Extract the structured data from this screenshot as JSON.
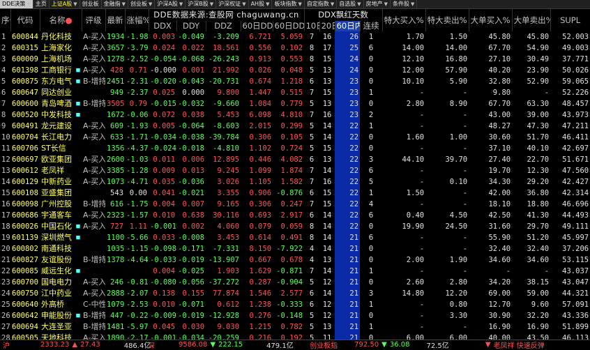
{
  "tabs": [
    {
      "label": "DDE决策",
      "arrow": "▼",
      "active": true
    },
    {
      "label": "主页",
      "arrow": ""
    },
    {
      "label": "上证A股",
      "arrow": "▼",
      "hl": true
    },
    {
      "label": "创业板",
      "arrow": ""
    },
    {
      "label": "金融指",
      "arrow": "▼"
    },
    {
      "label": "创业板",
      "arrow": "▼"
    },
    {
      "label": "沪深A股",
      "arrow": "▼"
    },
    {
      "label": "沪深B股",
      "arrow": "▼"
    },
    {
      "label": "沪深权证",
      "arrow": "▼"
    },
    {
      "label": "AH股",
      "arrow": "▼"
    },
    {
      "label": "板块指数",
      "arrow": "▼"
    },
    {
      "label": "自定指数",
      "arrow": "▼"
    },
    {
      "label": "自选股",
      "arrow": "▼"
    },
    {
      "label": "房地产",
      "arrow": "▼"
    },
    {
      "label": "条件股",
      "arrow": "▼"
    }
  ],
  "header": {
    "idx": "序号",
    "code": "代码",
    "name": "名称",
    "name_mark": "●",
    "rate": "评级",
    "latest": "最新",
    "pct": "涨幅%",
    "ddx_group": "DDE数据来源:查股网 chaguwang.cn",
    "red_group": "DDX飘红天数",
    "ddx": "DDX",
    "ddy": "DDY",
    "ddz": "DDZ",
    "ddx60": "60日DDX",
    "ddy60": "60日DDY",
    "r10": "10日内",
    "r20": "20日内",
    "r60": "60日内↓",
    "lianxu": "连续",
    "tdbuy": "特大买入%",
    "tdsell": "特大卖出%",
    "ddbuy": "大单买入%",
    "ddsell": "大单卖出%",
    "supl": "SUPL"
  },
  "rows": [
    [
      "1",
      "600844",
      "丹化科技",
      "",
      "A-买入",
      "1934",
      "-1.98",
      "0.003",
      "-0.049",
      "-3.209",
      "6.721",
      "5.059",
      "7",
      "16",
      "26",
      "1",
      "1.70",
      "1.50",
      "45.80",
      "45.80",
      "52.003"
    ],
    [
      "2",
      "600315",
      "上海家化",
      "",
      "A-买入",
      "3657",
      "-3.79",
      "0.024",
      "0.022",
      "18.561",
      "0.556",
      "0.102",
      "8",
      "17",
      "25",
      "6",
      "14.00",
      "14.00",
      "67.70",
      "54.90",
      "49.003"
    ],
    [
      "3",
      "600009",
      "上海机场",
      "",
      "A-买入",
      "1278",
      "-2.52",
      "-0.054",
      "-0.068",
      "-26.243",
      "0.913",
      "0.553",
      "8",
      "15",
      "24",
      "0",
      "12.10",
      "16.80",
      "27.10",
      "30.49",
      "37.771"
    ],
    [
      "4",
      "601398",
      "工商银行",
      "■",
      "A-买入",
      "428",
      "0.71",
      "-0.000",
      "0.001",
      "21.992",
      "0.026",
      "0.048",
      "5",
      "13",
      "24",
      "0",
      "12.00",
      "57.90",
      "40.20",
      "23.90",
      "50.026"
    ],
    [
      "5",
      "600875",
      "东方电气",
      "■",
      "B-增持",
      "2451",
      "-2.31",
      "-0.020",
      "-0.043",
      "-20.731",
      "0.674",
      "1.218",
      "6",
      "13",
      "23",
      "0",
      "10.10",
      "5.90",
      "32.80",
      "52.90",
      "59.065"
    ],
    [
      "6",
      "600647",
      "同达创业",
      "",
      "",
      "949",
      "-2.37",
      "0.025",
      "0.000",
      "9.800",
      "1.447",
      "0.515",
      "7",
      "15",
      "23",
      "1",
      "-",
      "-",
      "9.80",
      "-",
      "52.226"
    ],
    [
      "7",
      "600600",
      "青岛啤酒",
      "■",
      "B-增持",
      "3505",
      "0.79",
      "-0.015",
      "-0.032",
      "-9.660",
      "1.084",
      "0.779",
      "5",
      "13",
      "23",
      "0",
      "2.80",
      "8.90",
      "67.70",
      "63.30",
      "48.457"
    ],
    [
      "8",
      "600520",
      "中发科技",
      "■",
      "",
      "1672",
      "-0.06",
      "0.072",
      "0.038",
      "5.453",
      "6.098",
      "4.810",
      "7",
      "16",
      "23",
      "2",
      "-",
      "-",
      "43.00",
      "39.00",
      "43.973"
    ],
    [
      "9",
      "600491",
      "龙元建设",
      "",
      "A-买入",
      "609",
      "-1.93",
      "0.005",
      "-0.064",
      "-8.603",
      "2.015",
      "0.299",
      "5",
      "14",
      "22",
      "1",
      "-",
      "-",
      "48.27",
      "47.30",
      "47.211"
    ],
    [
      "10",
      "600704",
      "长江电力",
      "",
      "A-买入",
      "633",
      "-1.71",
      "-0.034",
      "-0.038",
      "-39.784",
      "0.306",
      "0.105",
      "5",
      "14",
      "22",
      "0",
      "1.60",
      "1.00",
      "30.60",
      "51.70",
      "46.411"
    ],
    [
      "11",
      "600706",
      "ST长信",
      "",
      "",
      "1356",
      "-4.37",
      "-0.024",
      "-0.018",
      "-4.810",
      "1.102",
      "0.724",
      "5",
      "15",
      "22",
      "0",
      "-",
      "-",
      "37.10",
      "40.10",
      "42.697"
    ],
    [
      "12",
      "600697",
      "欧亚集团",
      "",
      "A-买入",
      "2600",
      "-1.03",
      "0.011",
      "0.006",
      "12.895",
      "0.446",
      "4.082",
      "6",
      "13",
      "22",
      "3",
      "44.10",
      "39.70",
      "27.40",
      "22.70",
      "51.671"
    ],
    [
      "13",
      "600612",
      "老凤祥",
      "",
      "A-买入",
      "3385",
      "-1.28",
      "0.009",
      "0.013",
      "9.245",
      "1.099",
      "1.874",
      "7",
      "14",
      "22",
      "6",
      "-",
      "-",
      "19.70",
      "12.30",
      "47.560"
    ],
    [
      "14",
      "600129",
      "中新药业",
      "",
      "A-买入",
      "1073",
      "-4.71",
      "0.035",
      "-0.036",
      "3.026",
      "1.105",
      "1.582",
      "7",
      "16",
      "22",
      "5",
      "-",
      "0.10",
      "34.30",
      "29.20",
      "42.427"
    ],
    [
      "15",
      "600108",
      "亚盛集团",
      "",
      "",
      "543",
      "0.00",
      "0.041",
      "-0.021",
      "3.355",
      "0.906",
      "-0.876",
      "6",
      "15",
      "22",
      "1",
      "1.50",
      "-",
      "42.00",
      "36.80",
      "42.314"
    ],
    [
      "16",
      "600098",
      "广州控股",
      "",
      "B-增持",
      "616",
      "-1.75",
      "0.004",
      "0.007",
      "9.165",
      "0.306",
      "0.247",
      "7",
      "15",
      "22",
      "4",
      "-",
      "-",
      "18.10",
      "18.80",
      "46.696"
    ],
    [
      "17",
      "600686",
      "宇通客车",
      "",
      "A-买入",
      "2323",
      "-1.57",
      "0.010",
      "0.638",
      "30.116",
      "0.693",
      "2.917",
      "6",
      "14",
      "22",
      "6",
      "0.40",
      "4.50",
      "42.50",
      "41.30",
      "44.493"
    ],
    [
      "18",
      "600026",
      "中国石化",
      "■",
      "A-买入",
      "727",
      "1.11",
      "-0.001",
      "0.002",
      "4.060",
      "0.079",
      "0.059",
      "8",
      "14",
      "22",
      "0",
      "19.90",
      "24.50",
      "31.60",
      "29.70",
      "49.111"
    ],
    [
      "19",
      "601139",
      "深圳燃气",
      "■",
      "",
      "1100",
      "-5.66",
      "0.033",
      "-0.008",
      "3.453",
      "0.614",
      "0.491",
      "8",
      "14",
      "21",
      "6",
      "-",
      "-",
      "55.90",
      "51.20",
      "45.997"
    ],
    [
      "20",
      "600802",
      "南通科技",
      "",
      "",
      "1035",
      "-1.15",
      "-0.098",
      "-0.171",
      "-7.331",
      "8.150",
      "-7.922",
      "4",
      "14",
      "21",
      "0",
      "-",
      "-",
      "32.40",
      "32.40",
      "37.206"
    ],
    [
      "21",
      "600827",
      "友谊股份",
      "",
      "B-增持",
      "1378",
      "-4.64",
      "-0.033",
      "-0.019",
      "-13.907",
      "0.667",
      "0.678",
      "4",
      "13",
      "21",
      "0",
      "2.00",
      "1.90",
      "34.60",
      "34.60",
      "53.115"
    ],
    [
      "22",
      "600085",
      "威远生化",
      "■",
      "",
      "",
      "",
      "0.004",
      "-0.025",
      "1.903",
      "1.629",
      "-0.871",
      "7",
      "14",
      "21",
      "1",
      "-",
      "-",
      "-",
      "-",
      "43.037"
    ],
    [
      "23",
      "600700",
      "国电电力",
      "",
      "A-买入",
      "246",
      "-0.81",
      "-0.080",
      "-0.056",
      "-37.272",
      "0.287",
      "-0.904",
      "5",
      "12",
      "21",
      "0",
      "2.60",
      "2.80",
      "34.20",
      "38.15",
      "43.047"
    ],
    [
      "24",
      "600750",
      "江中药业",
      "",
      "A-买入",
      "2888",
      "-2.07",
      "0.138",
      "0.155",
      "77.874",
      "1.546",
      "2.577",
      "6",
      "14",
      "21",
      "3",
      "14.80",
      "12.20",
      "69.00",
      "59.00",
      "44.321"
    ],
    [
      "25",
      "600640",
      "外高桥",
      "",
      "C-中性",
      "1079",
      "-2.53",
      "0.010",
      "-0.071",
      "0.612",
      "1.238",
      "-0.333",
      "6",
      "12",
      "21",
      "1",
      "-",
      "0.80",
      "12.70",
      "9.60",
      "57.091"
    ],
    [
      "26",
      "600642",
      "申能股份",
      "■",
      "B-增持",
      "447",
      "-0.22",
      "-0.009",
      "-0.019",
      "-12.928",
      "0.276",
      "-0.148",
      "5",
      "12",
      "21",
      "0",
      "-",
      "3.30",
      "30.90",
      "32.20",
      "43.336"
    ],
    [
      "27",
      "600694",
      "大连圣亚",
      "",
      "B-增持",
      "1481",
      "-5.97",
      "0.045",
      "0.030",
      "9.030",
      "1.215",
      "0.782",
      "5",
      "13",
      "21",
      "1",
      "-",
      "-",
      "16.90",
      "16.90",
      "51.899"
    ],
    [
      "28",
      "600505",
      "天地科技",
      "",
      "A-买入",
      "1890",
      "-2.17",
      "-0.001",
      "-0.034",
      "-20.259",
      "0.216",
      "0.192",
      "5",
      "11",
      "21",
      "0",
      "6.00",
      "6.00",
      "40.00",
      "43.50",
      "46.113"
    ],
    [
      "29",
      "600745",
      "恒生电子",
      "",
      "A-买入",
      "1254",
      "-3.32",
      "0.000",
      "-0.022",
      "0.000",
      "0.251",
      "0.458",
      "5",
      "11",
      "21",
      "0",
      "6.00",
      "-",
      "32.00",
      "-",
      "48.015"
    ],
    [
      "30",
      "600011",
      "深赤湾",
      "",
      "A-买入",
      "1820",
      "-1.01",
      "0.012",
      "0.003",
      "8.411",
      "0.333",
      "0.121",
      "6",
      "12",
      "21",
      "1",
      "-",
      "-",
      "11.40",
      "-",
      "48.802"
    ]
  ],
  "status": {
    "sh_label": "沪",
    "sh_value": "2333.23",
    "sh_chg": "27.43",
    "sh_vol": "486.4亿",
    "sz_label": "深",
    "sz_value": "9586.08",
    "sz_chg": "222.15",
    "sz_vol": "479.1亿",
    "cy_label": "创业板指",
    "cy_value": "792.50",
    "cy_chg": "36.08",
    "cy_vol": "72.5亿",
    "news": "老凤祥 快速反弹"
  }
}
